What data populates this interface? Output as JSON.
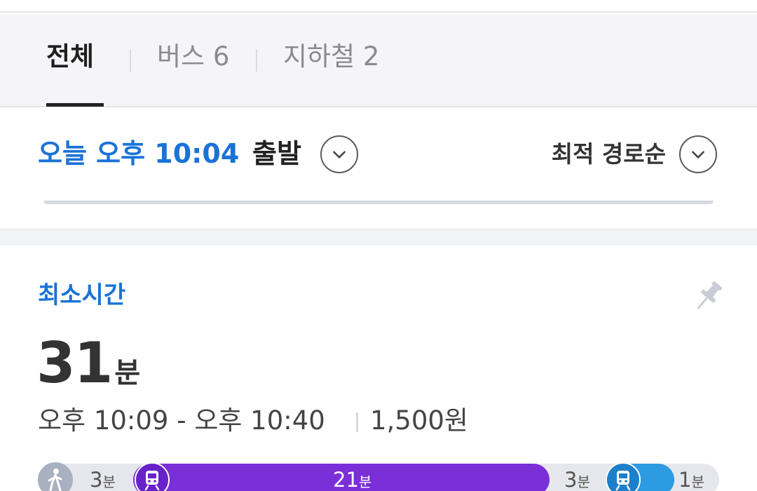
{
  "tabs": [
    {
      "label": "전체",
      "active": true
    },
    {
      "label": "버스 6",
      "active": false
    },
    {
      "label": "지하철 2",
      "active": false
    }
  ],
  "departure": {
    "time_text": "오늘 오후 10:04",
    "suffix": "출발",
    "accent_color": "#1a73d6"
  },
  "sort": {
    "label": "최적 경로순"
  },
  "route": {
    "label": "최소시간",
    "duration_value": "31",
    "duration_unit": "분",
    "time_range": "오후 10:09 - 오후 10:40",
    "fare": "1,500원",
    "segments": [
      {
        "mode": "walk",
        "icon": "walk-icon",
        "minutes": "3",
        "unit": "분"
      },
      {
        "mode": "subway",
        "icon": "subway-icon",
        "minutes": "21",
        "unit": "분",
        "color": "#7b2fd9"
      },
      {
        "mode": "walk",
        "minutes": "3",
        "unit": "분"
      },
      {
        "mode": "subway",
        "icon": "subway-icon",
        "minutes": "1",
        "unit": "분",
        "color": "#2d9be2"
      }
    ]
  }
}
